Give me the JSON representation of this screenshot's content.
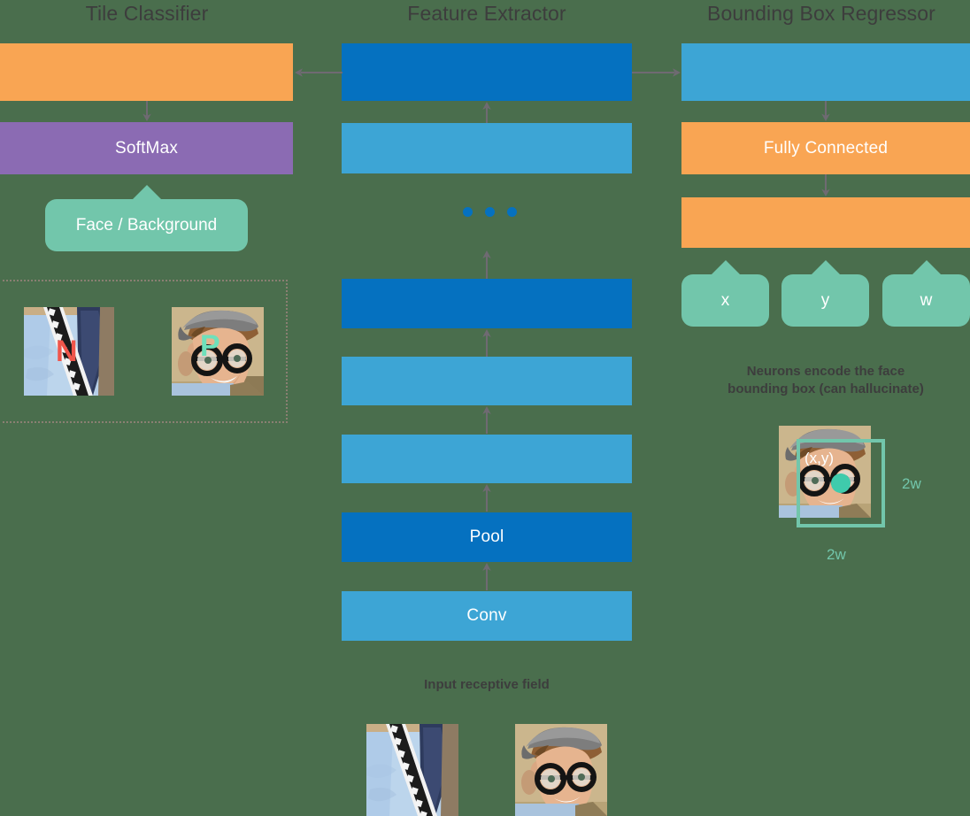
{
  "columns": {
    "left": {
      "title": "Tile Classifier"
    },
    "center": {
      "title": "Feature Extractor"
    },
    "right": {
      "title": "Bounding Box Regressor"
    }
  },
  "left_column": {
    "layers": [
      {
        "label": "",
        "color": "#f9a553"
      },
      {
        "label": "SoftMax",
        "color": "#8b6bb3"
      }
    ],
    "output_bubble": "Face / Background",
    "tiles": [
      {
        "mark": "N",
        "mark_color": "#f0554b",
        "alt": "negative-tile-shirt"
      },
      {
        "mark": "P",
        "mark_color": "#6ee0bb",
        "alt": "positive-tile-face"
      }
    ]
  },
  "center_column": {
    "layers": [
      {
        "label": "",
        "color": "#0571c0"
      },
      {
        "label": "",
        "color": "#3da5d5"
      },
      {
        "label": "",
        "color": "#0571c0"
      },
      {
        "label": "",
        "color": "#3da5d5"
      },
      {
        "label": "",
        "color": "#3da5d5"
      },
      {
        "label": "Pool",
        "color": "#0571c0"
      },
      {
        "label": "Conv",
        "color": "#3da5d5"
      }
    ],
    "ellipsis_dots": 3,
    "input_caption": "Input receptive field",
    "input_tiles": [
      {
        "alt": "input-tile-shirt"
      },
      {
        "alt": "input-tile-face"
      }
    ]
  },
  "right_column": {
    "layers": [
      {
        "label": "",
        "color": "#3da5d5"
      },
      {
        "label": "Fully Connected",
        "color": "#f9a553"
      },
      {
        "label": "",
        "color": "#f9a553"
      }
    ],
    "neuron_bubbles": [
      "x",
      "y",
      "w"
    ],
    "note": "Neurons encode the face\nbounding box (can hallucinate)",
    "note_line1": "Neurons encode the face",
    "note_line2": "bounding box (can hallucinate)",
    "bbox_example": {
      "origin_label": "(x,y)",
      "width_label": "2w",
      "height_label": "2w"
    }
  },
  "colors": {
    "background": "#4a6e4d",
    "dark_blue": "#0571c0",
    "light_blue": "#3da5d5",
    "orange": "#f9a553",
    "purple": "#8b6bb3",
    "teal": "#72c6ab",
    "arrow": "#6f6a72",
    "text_dark": "#3d3d3d"
  }
}
